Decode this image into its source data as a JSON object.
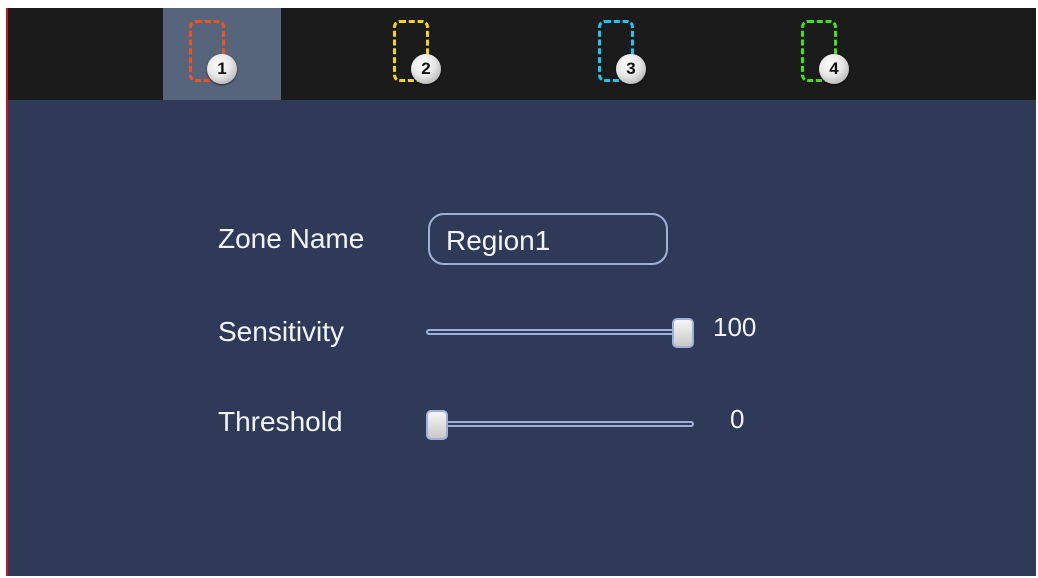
{
  "region_tabs": [
    {
      "number": "1",
      "color": "#f4511e",
      "selected": true
    },
    {
      "number": "2",
      "color": "#f2d51d",
      "selected": false
    },
    {
      "number": "3",
      "color": "#19c8f0",
      "selected": false
    },
    {
      "number": "4",
      "color": "#3ee414",
      "selected": false
    }
  ],
  "zone_name": {
    "label": "Zone Name",
    "value": "Region1"
  },
  "sensitivity": {
    "label": "Sensitivity",
    "value": "100",
    "level": 1.0
  },
  "threshold": {
    "label": "Threshold",
    "value": "0",
    "level": 0.0
  }
}
